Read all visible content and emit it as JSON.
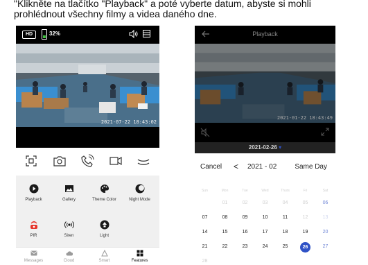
{
  "caption": "\"Klikněte na tlačítko \"Playback\" a poté vyberte datum, abyste si mohli prohlédnout všechny filmy a videa daného dne.",
  "live_view": {
    "hd_label": "HD",
    "battery_percent": 32,
    "battery_label": "32%",
    "timestamp": "2021-07-22 18:43:02",
    "top_icons": [
      "speaker-icon",
      "menu-icon"
    ],
    "controls": [
      "screenshot-icon",
      "camera-icon",
      "talk-icon",
      "record-icon",
      "more-icon"
    ],
    "features": [
      {
        "label": "Playback",
        "icon": "playback-icon"
      },
      {
        "label": "Gallery",
        "icon": "gallery-icon"
      },
      {
        "label": "Theme Color",
        "icon": "palette-icon"
      },
      {
        "label": "Night Mode",
        "icon": "night-mode-icon"
      },
      {
        "label": "PIR",
        "icon": "pir-icon"
      },
      {
        "label": "Siren",
        "icon": "siren-icon"
      },
      {
        "label": "Light",
        "icon": "light-icon"
      }
    ],
    "tabs": [
      {
        "label": "Messages",
        "icon": "messages-icon",
        "active": false
      },
      {
        "label": "Cloud",
        "icon": "cloud-icon",
        "active": false
      },
      {
        "label": "Smart",
        "icon": "smart-icon",
        "active": false
      },
      {
        "label": "Features",
        "icon": "features-icon",
        "active": true
      }
    ],
    "colors": {
      "pir": "#e5342b",
      "active_tab": "#111111"
    }
  },
  "playback": {
    "title": "Playback",
    "timestamp": "2021-01-22 18:43:49",
    "selected_date": "2021-02-26",
    "date_arrow": "▾",
    "calendar": {
      "cancel_label": "Cancel",
      "prev_glyph": "<",
      "month_label": "2021 - 02",
      "same_day_label": "Same Day",
      "weekdays": [
        "Sun",
        "Mon",
        "Tue",
        "Wed",
        "Thurs",
        "Fri",
        "Sat"
      ],
      "weeks": [
        [
          "",
          "01",
          "02",
          "03",
          "04",
          "05",
          "06"
        ],
        [
          "07",
          "08",
          "09",
          "10",
          "11",
          "12",
          "13"
        ],
        [
          "14",
          "15",
          "16",
          "17",
          "18",
          "19",
          "20"
        ],
        [
          "21",
          "22",
          "23",
          "24",
          "25",
          "26",
          "27"
        ],
        [
          "28",
          "",
          "",
          "",
          "",
          "",
          ""
        ]
      ],
      "available_days": [
        "06",
        "07",
        "08",
        "09",
        "10",
        "11",
        "14",
        "15",
        "16",
        "17",
        "18",
        "19",
        "20",
        "21",
        "22",
        "23",
        "24",
        "25",
        "26",
        "27"
      ],
      "selected_day": "26",
      "accent_color": "#2f52c6"
    }
  }
}
